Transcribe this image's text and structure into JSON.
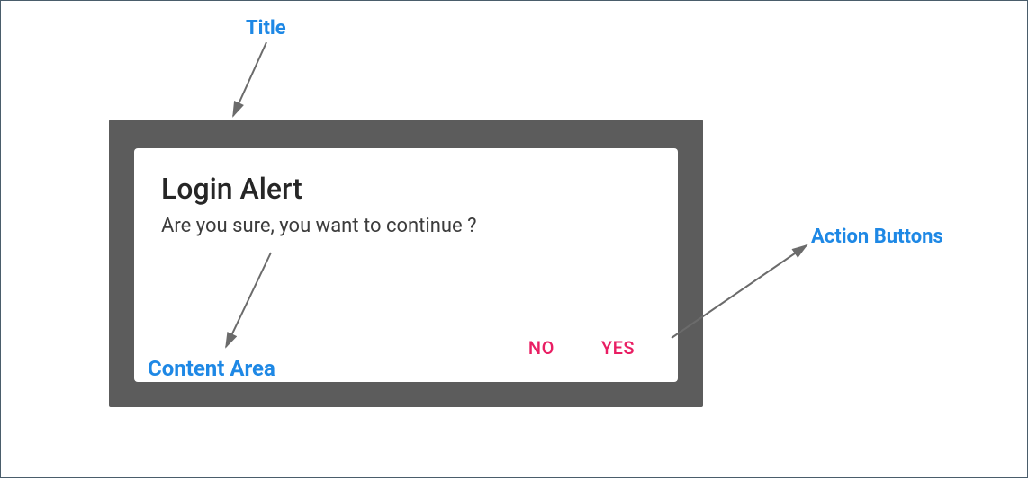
{
  "annotations": {
    "title": "Title",
    "content_area": "Content Area",
    "action_buttons": "Action Buttons"
  },
  "dialog": {
    "title": "Login Alert",
    "content": "Are you sure, you want to continue ?",
    "actions": {
      "no": "NO",
      "yes": "YES"
    }
  },
  "colors": {
    "annotation": "#1e88e5",
    "backdrop": "#5c5c5c",
    "action_button": "#e91e63",
    "arrow": "#6b6b6b"
  }
}
